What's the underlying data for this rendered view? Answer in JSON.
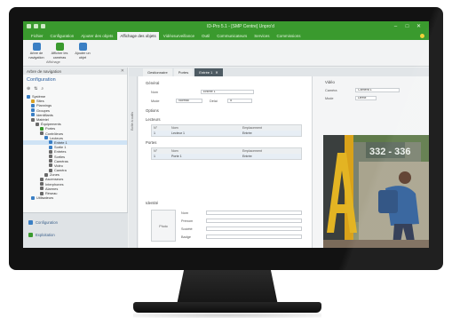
{
  "app": {
    "title": "ID-Pro 5.1 - [SMP Centre] Unpro'd",
    "window_controls": [
      "–",
      "□",
      "✕"
    ]
  },
  "ribbon": {
    "tabs": [
      "Fichier",
      "Configuration",
      "Ajouter des objets",
      "Affichage des objets",
      "Vidéosurveillance",
      "Outil",
      "Communicateurs",
      "Services",
      "Commissions"
    ],
    "active_tab_index": 3,
    "buttons": [
      {
        "label": "Arbre de navigation",
        "icon": "tree-icon",
        "color": "#3a7fc4"
      },
      {
        "label": "Afficher les caméras",
        "icon": "camera-icon",
        "color": "#3a9a2e"
      },
      {
        "label": "Ajouter un objet",
        "icon": "add-icon",
        "color": "#3a7fc4"
      }
    ],
    "group_label": "Affichage"
  },
  "left_panel": {
    "header": "Arbre de navigation",
    "title": "Configuration",
    "tools": [
      "⊕",
      "⇅",
      "⌕"
    ],
    "tree": [
      {
        "label": "Système",
        "depth": 0,
        "icon_color": "#3a7fc4"
      },
      {
        "label": "Sites",
        "depth": 1,
        "icon_color": "#d8a124"
      },
      {
        "label": "Plannings",
        "depth": 1,
        "icon_color": "#3a7fc4"
      },
      {
        "label": "Groupes",
        "depth": 1,
        "icon_color": "#3a7fc4"
      },
      {
        "label": "Identifiants",
        "depth": 1,
        "icon_color": "#3a7fc4"
      },
      {
        "label": "Matériel",
        "depth": 1,
        "icon_color": "#6a6a6a"
      },
      {
        "label": "Équipements",
        "depth": 2,
        "icon_color": "#6a6a6a"
      },
      {
        "label": "Portes",
        "depth": 3,
        "icon_color": "#3a9a2e"
      },
      {
        "label": "Contrôleurs",
        "depth": 3,
        "icon_color": "#6a6a6a"
      },
      {
        "label": "Lecteurs",
        "depth": 4,
        "icon_color": "#3a7fc4"
      },
      {
        "label": "Entrée 1",
        "depth": 5,
        "icon_color": "#3a7fc4",
        "selected": true
      },
      {
        "label": "Sortie 1",
        "depth": 5,
        "icon_color": "#3a7fc4"
      },
      {
        "label": "Entrées",
        "depth": 5,
        "icon_color": "#6a6a6a"
      },
      {
        "label": "Sorties",
        "depth": 5,
        "icon_color": "#6a6a6a"
      },
      {
        "label": "Caméras",
        "depth": 5,
        "icon_color": "#6a6a6a"
      },
      {
        "label": "Vidéo",
        "depth": 5,
        "icon_color": "#6a6a6a"
      },
      {
        "label": "Caméra",
        "depth": 5,
        "icon_color": "#6a6a6a"
      },
      {
        "label": "Zones",
        "depth": 4,
        "icon_color": "#6a6a6a"
      },
      {
        "label": "Ascenseurs",
        "depth": 3,
        "icon_color": "#6a6a6a"
      },
      {
        "label": "Interphones",
        "depth": 3,
        "icon_color": "#6a6a6a"
      },
      {
        "label": "Alarmes",
        "depth": 3,
        "icon_color": "#6a6a6a"
      },
      {
        "label": "Réseau",
        "depth": 3,
        "icon_color": "#6a6a6a"
      },
      {
        "label": "Utilisateurs",
        "depth": 1,
        "icon_color": "#3a7fc4"
      }
    ],
    "bottom_items": [
      {
        "label": "Configuration",
        "icon_color": "#3a7fc4"
      },
      {
        "label": "Exploitation",
        "icon_color": "#3a9a2e"
      }
    ]
  },
  "doc_tabs": [
    {
      "label": "Gestionnaire",
      "active": false
    },
    {
      "label": "Portes",
      "active": false
    },
    {
      "label": "Entrée 1",
      "active": true
    }
  ],
  "toolbox_label": "Boîte à outils",
  "form": {
    "section_main": "Général",
    "name_label": "Nom",
    "name_value": "Entrée 1",
    "mode_label": "Mode",
    "mode_value": "Normal",
    "delay_label": "Délai",
    "delay_value": "5",
    "section_options": "Options",
    "section_readers": "Lecteurs",
    "grid1_headers": [
      "N°",
      "Nom",
      "Emplacement"
    ],
    "grid1_row": [
      "1",
      "Lecteur 1",
      "Entrée"
    ],
    "section_doors": "Portes",
    "grid2_headers": [
      "N°",
      "Nom",
      "Emplacement"
    ],
    "grid2_row": [
      "1",
      "Porte 1",
      "Entrée"
    ],
    "section_identity": "Identité",
    "photo_label": "Photo",
    "identity_fields": [
      "Nom",
      "Prénom",
      "Société",
      "Badge"
    ]
  },
  "right_panel": {
    "title": "Vidéo",
    "camera_label": "Caméra",
    "camera_value": "Caméra 1",
    "mode_label": "Mode",
    "mode_value": "Direct",
    "sign_text": "332 - 336",
    "letter": "A"
  },
  "colors": {
    "accent_green": "#3a9a2e",
    "selection_blue": "#cfe3f5",
    "active_tab": "#4e5b63"
  }
}
